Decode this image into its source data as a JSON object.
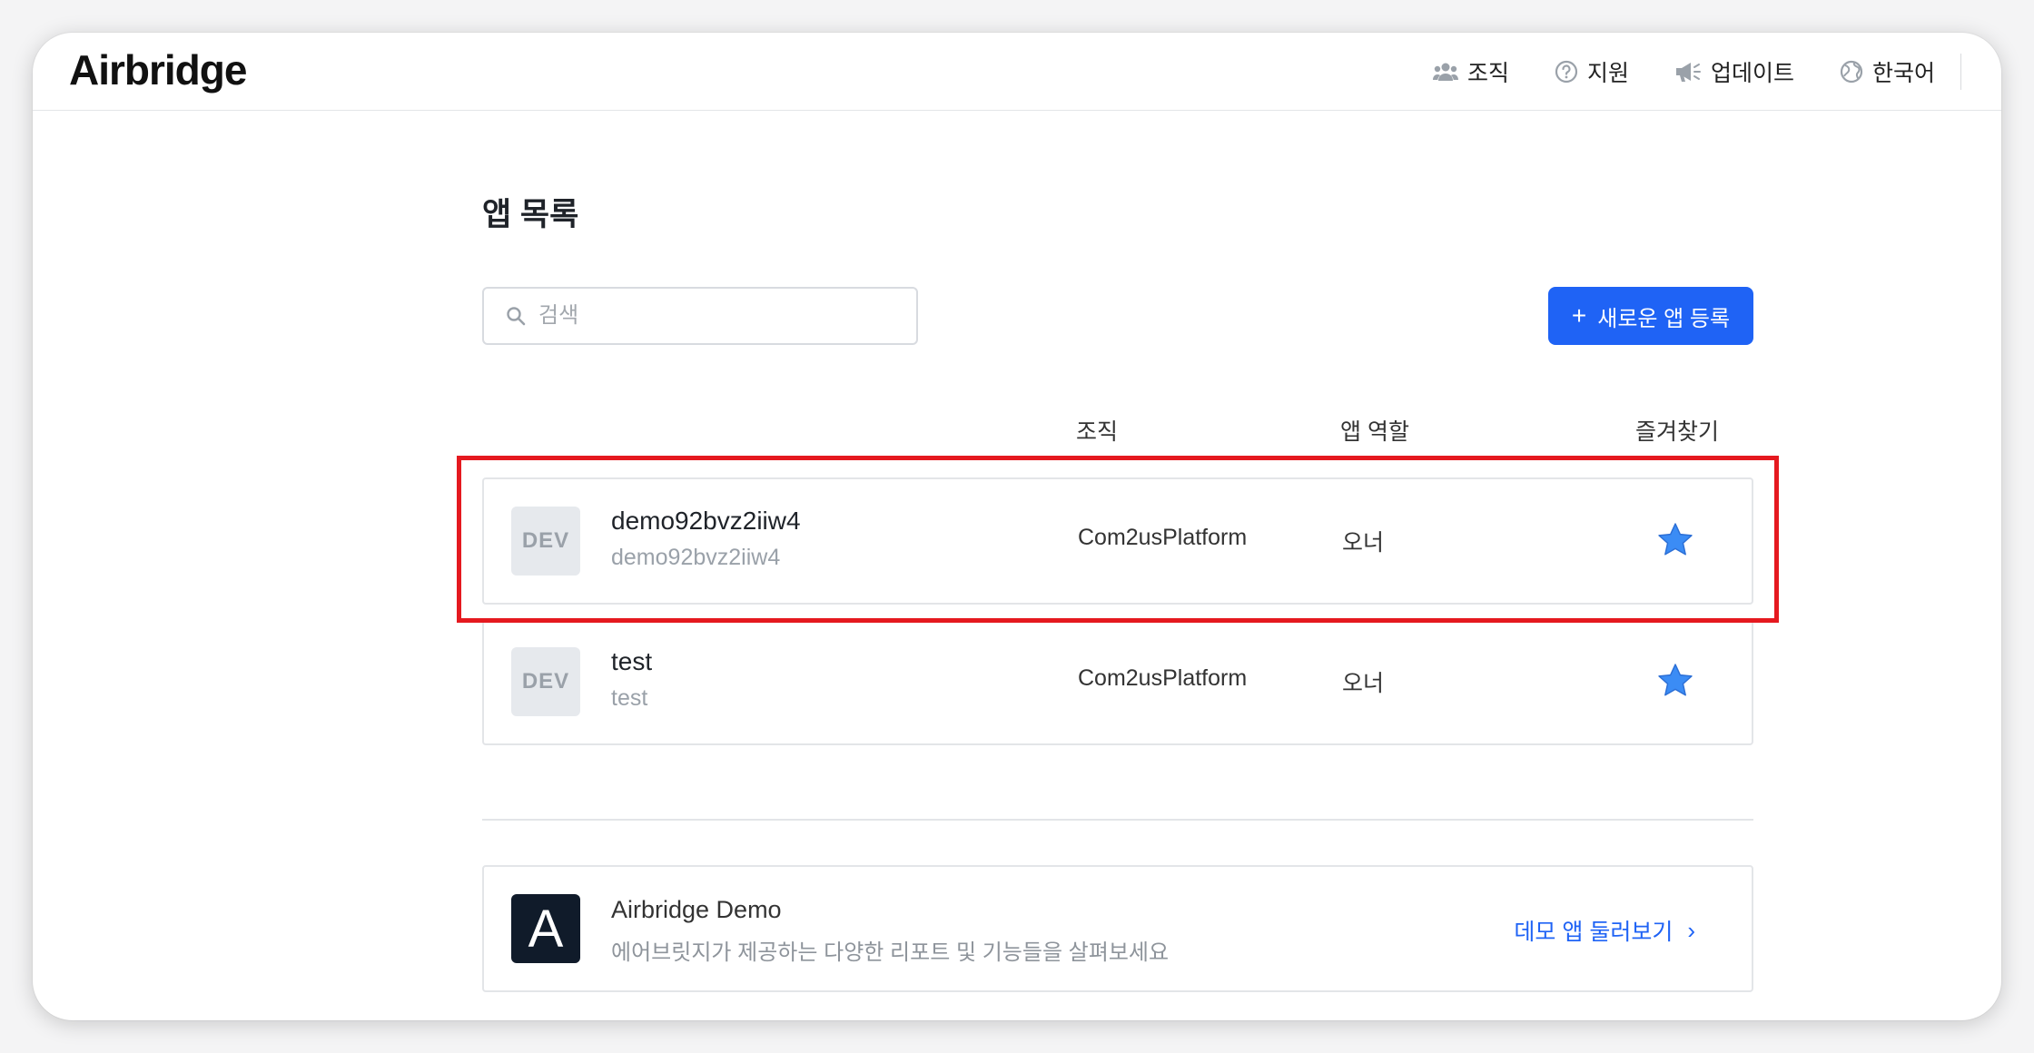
{
  "header": {
    "logo": "Airbridge",
    "nav": [
      {
        "label": "조직",
        "icon": "team-icon"
      },
      {
        "label": "지원",
        "icon": "help-icon"
      },
      {
        "label": "업데이트",
        "icon": "megaphone-icon"
      },
      {
        "label": "한국어",
        "icon": "globe-icon"
      }
    ]
  },
  "page": {
    "title": "앱 목록",
    "search_placeholder": "검색",
    "new_app_button": "새로운 앱 등록",
    "new_app_plus": "+"
  },
  "table": {
    "columns": {
      "org": "조직",
      "role": "앱 역할",
      "favorite": "즐겨찾기"
    },
    "rows": [
      {
        "badge": "DEV",
        "name": "demo92bvz2iiw4",
        "sub": "demo92bvz2iiw4",
        "org": "Com2usPlatform",
        "role": "오너",
        "favorite": true
      },
      {
        "badge": "DEV",
        "name": "test",
        "sub": "test",
        "org": "Com2usPlatform",
        "role": "오너",
        "favorite": true
      }
    ]
  },
  "demo": {
    "logo_letter": "A",
    "title": "Airbridge Demo",
    "description": "에어브릿지가 제공하는 다양한 리포트 및 기능들을 살펴보세요",
    "link": "데모 앱 둘러보기",
    "link_chevron": "›"
  },
  "colors": {
    "accent": "#1f63f5",
    "star": "#3b8cf5",
    "highlight": "#e5191f"
  }
}
